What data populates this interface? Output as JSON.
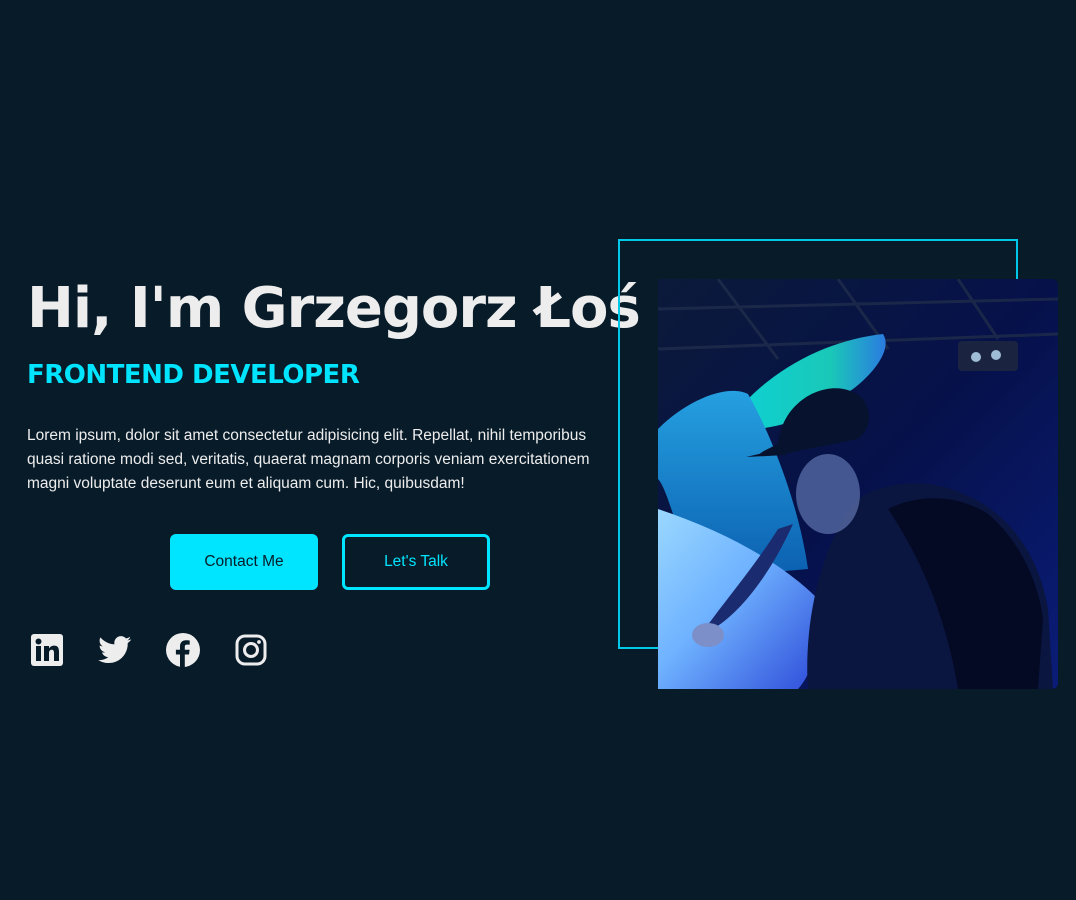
{
  "hero": {
    "title": "Hi, I'm Grzegorz Łoś",
    "role": "FRONTEND DEVELOPER",
    "description": "Lorem ipsum, dolor sit amet consectetur adipisicing elit. Repellat, nihil temporibus quasi ratione modi sed, veritatis, quaerat magnam corporis veniam exercitationem magni voluptate deserunt eum et aliquam cum. Hic, quibusdam!"
  },
  "buttons": {
    "contact_label": "Contact Me",
    "talk_label": "Let's Talk"
  },
  "social": [
    {
      "icon": "linkedin-icon"
    },
    {
      "icon": "twitter-icon"
    },
    {
      "icon": "facebook-icon"
    },
    {
      "icon": "instagram-icon"
    }
  ],
  "colors": {
    "background": "#081b29",
    "accent": "#00e5ff",
    "text": "#ededed"
  }
}
